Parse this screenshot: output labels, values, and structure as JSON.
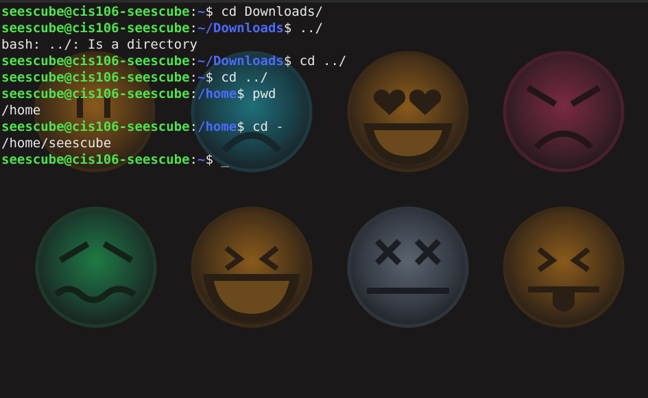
{
  "colors": {
    "background": "#1b1819",
    "user_host": "#4ee44e",
    "path": "#4b6bff",
    "text": "#e8e8e8"
  },
  "wallpaper_icons": [
    "neutral-face-icon",
    "sad-face-icon",
    "heart-eyes-face-icon",
    "angry-face-icon",
    "wavy-mouth-face-icon",
    "laughing-face-icon",
    "dizzy-face-icon",
    "tongue-out-face-icon"
  ],
  "terminal": {
    "lines": [
      {
        "type": "prompt",
        "user": "seescube@cis106-seescube",
        "colon": ":",
        "path": "~",
        "sign": "$ ",
        "cmd": "cd Downloads/"
      },
      {
        "type": "prompt",
        "user": "seescube@cis106-seescube",
        "colon": ":",
        "path": "~/Downloads",
        "sign": "$ ",
        "cmd": "../"
      },
      {
        "type": "output",
        "text": "bash: ../: Is a directory"
      },
      {
        "type": "prompt",
        "user": "seescube@cis106-seescube",
        "colon": ":",
        "path": "~/Downloads",
        "sign": "$ ",
        "cmd": "cd ../"
      },
      {
        "type": "prompt",
        "user": "seescube@cis106-seescube",
        "colon": ":",
        "path": "~",
        "sign": "$ ",
        "cmd": "cd ../"
      },
      {
        "type": "prompt",
        "user": "seescube@cis106-seescube",
        "colon": ":",
        "path": "/home",
        "sign": "$ ",
        "cmd": "pwd"
      },
      {
        "type": "output",
        "text": "/home"
      },
      {
        "type": "prompt",
        "user": "seescube@cis106-seescube",
        "colon": ":",
        "path": "/home",
        "sign": "$ ",
        "cmd": "cd -"
      },
      {
        "type": "output",
        "text": "/home/seescube"
      },
      {
        "type": "prompt",
        "user": "seescube@cis106-seescube",
        "colon": ":",
        "path": "~",
        "sign": "$ ",
        "cmd": "",
        "cursor": "_"
      }
    ]
  }
}
